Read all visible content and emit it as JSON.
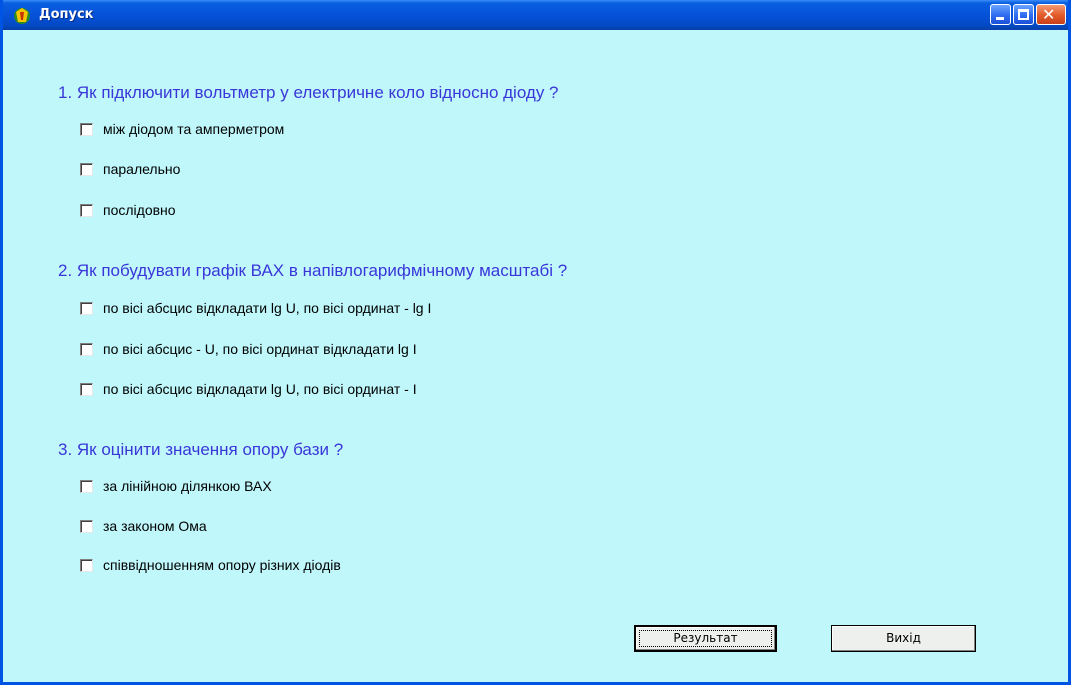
{
  "window": {
    "title": "Допуск",
    "controls": [
      "minimize-icon",
      "maximize-icon",
      "close-icon"
    ]
  },
  "questions": [
    {
      "text": "1. Як підключити вольтметр у електричне коло відносно діоду ?",
      "options": [
        {
          "label": "між діодом та амперметром",
          "checked": false
        },
        {
          "label": "паралельно",
          "checked": false
        },
        {
          "label": "послідовно",
          "checked": false
        }
      ]
    },
    {
      "text": "2. Як побудувати графік ВАХ в напівлогарифмічному масштабі ?",
      "options": [
        {
          "label": "по вісі абсцис відкладати lg U, по вісі ординат - lg I",
          "checked": false
        },
        {
          "label": "по вісі абсцис - U, по вісі ординат відкладати lg I",
          "checked": false
        },
        {
          "label": "по вісі абсцис відкладати lg U, по вісі ординат - I",
          "checked": false
        }
      ]
    },
    {
      "text": "3. Як оцінити значення опору бази ?",
      "options": [
        {
          "label": "за лінійною  ділянкою ВАХ",
          "checked": false
        },
        {
          "label": "за законом Ома",
          "checked": false
        },
        {
          "label": "співвідношенням опору різних діодів",
          "checked": false
        }
      ]
    }
  ],
  "buttons": {
    "result": "Результат",
    "exit": "Вихід"
  },
  "colors": {
    "background": "#bff7fb",
    "question_text": "#3a36d8",
    "titlebar": "#0552d9"
  }
}
